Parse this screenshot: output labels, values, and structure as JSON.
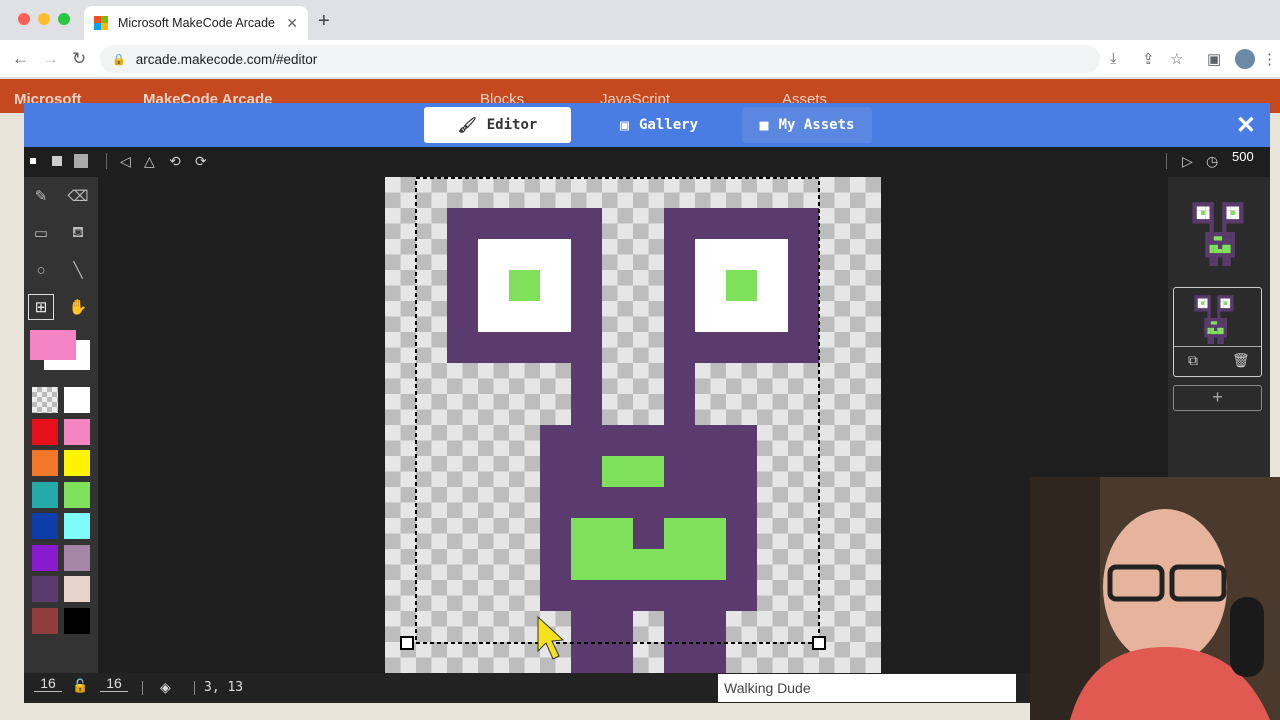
{
  "browser": {
    "tab_title": "Microsoft MakeCode Arcade",
    "url": "arcade.makecode.com/#editor"
  },
  "background_app": {
    "logo": "Microsoft",
    "app_name": "MakeCode Arcade",
    "tabs": [
      "Blocks",
      "JavaScript",
      "Assets"
    ]
  },
  "editor": {
    "tabs": [
      {
        "label": "Editor",
        "icon": "brush-icon",
        "active": true
      },
      {
        "label": "Gallery",
        "icon": "image-icon",
        "active": false
      },
      {
        "label": "My Assets",
        "icon": "folder-icon",
        "active": false
      }
    ],
    "interval": "500",
    "width": "16",
    "height": "16",
    "cursor_pos": "3, 13",
    "asset_name": "Walking Dude",
    "colors": {
      "accent": "#4a7de4",
      "purple": "#5b3a6e",
      "green": "#7ee05b",
      "selected_color": "#f484c4"
    },
    "palette": [
      [
        "transparent",
        "#ffffff"
      ],
      [
        "#e4111d",
        "#f484c4"
      ],
      [
        "#f1782a",
        "#fff305"
      ],
      [
        "#25a8a8",
        "#7ee05b"
      ],
      [
        "#0b3ea8",
        "#7efcfc"
      ],
      [
        "#8a1acd",
        "#a686a7"
      ],
      [
        "#5b3a6e",
        "#e7d3c9"
      ],
      [
        "#913d3d",
        "#000000"
      ]
    ]
  }
}
